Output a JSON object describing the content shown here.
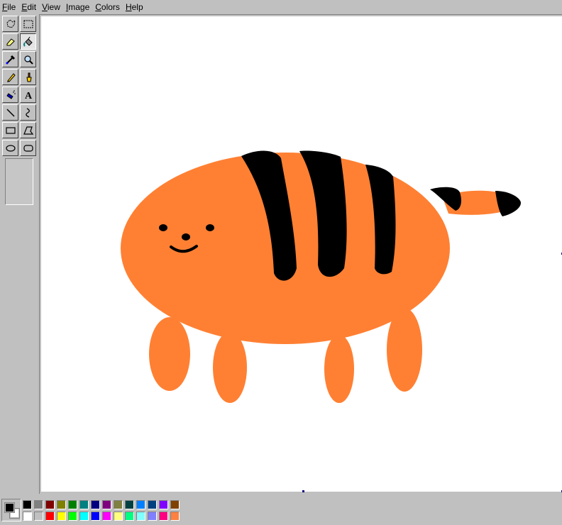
{
  "menu": [
    {
      "id": "file",
      "label": "File"
    },
    {
      "id": "edit",
      "label": "Edit"
    },
    {
      "id": "view",
      "label": "View"
    },
    {
      "id": "image",
      "label": "Image"
    },
    {
      "id": "colors",
      "label": "Colors"
    },
    {
      "id": "help",
      "label": "Help"
    }
  ],
  "tools": [
    {
      "icon": "free-form-select-icon",
      "active": false
    },
    {
      "icon": "rectangle-select-icon",
      "active": false
    },
    {
      "icon": "eraser-icon",
      "active": false
    },
    {
      "icon": "fill-bucket-icon",
      "active": true
    },
    {
      "icon": "color-picker-icon",
      "active": false
    },
    {
      "icon": "magnifier-icon",
      "active": false
    },
    {
      "icon": "pencil-icon",
      "active": false
    },
    {
      "icon": "brush-icon",
      "active": false
    },
    {
      "icon": "airbrush-icon",
      "active": false
    },
    {
      "icon": "text-icon",
      "active": false
    },
    {
      "icon": "line-icon",
      "active": false
    },
    {
      "icon": "curve-icon",
      "active": false
    },
    {
      "icon": "rectangle-icon",
      "active": false
    },
    {
      "icon": "polygon-icon",
      "active": false
    },
    {
      "icon": "ellipse-icon",
      "active": false
    },
    {
      "icon": "rounded-rectangle-icon",
      "active": false
    }
  ],
  "text_tool_glyph": "A",
  "colors": {
    "foreground": "#000000",
    "background": "#ffffff",
    "tiger_body": "#ff8033",
    "stripes": "#000000",
    "canvas": "#ffffff",
    "ui_face": "#c0c0c0"
  },
  "palette": {
    "row1": [
      "#000000",
      "#808080",
      "#800000",
      "#808000",
      "#008000",
      "#008080",
      "#000080",
      "#800080",
      "#808040",
      "#004040",
      "#0080ff",
      "#004080",
      "#8000ff",
      "#804000"
    ],
    "row2": [
      "#ffffff",
      "#c0c0c0",
      "#ff0000",
      "#ffff00",
      "#00ff00",
      "#00ffff",
      "#0000ff",
      "#ff00ff",
      "#ffff80",
      "#00ff80",
      "#80ffff",
      "#8080ff",
      "#ff0080",
      "#ff8040"
    ]
  }
}
